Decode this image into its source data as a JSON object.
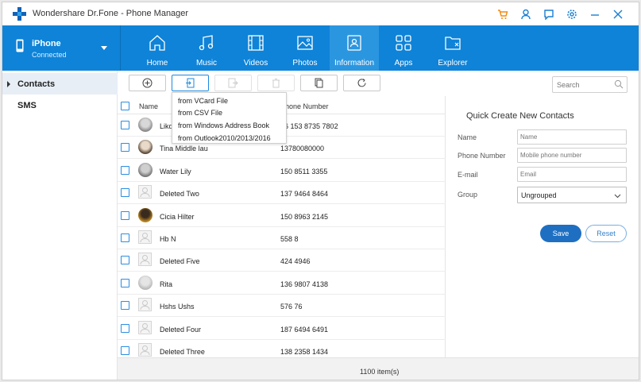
{
  "app": {
    "title": "Wondershare Dr.Fone - Phone Manager",
    "accent_color": "#0e83d8",
    "titlebar_icons": [
      "cart-icon",
      "user-icon",
      "feedback-icon",
      "gear-icon",
      "minimize-icon",
      "close-icon"
    ]
  },
  "device": {
    "name": "iPhone",
    "status": "Connected"
  },
  "nav": {
    "tabs": [
      {
        "label": "Home",
        "icon": "home-icon"
      },
      {
        "label": "Music",
        "icon": "music-icon"
      },
      {
        "label": "Videos",
        "icon": "videos-icon"
      },
      {
        "label": "Photos",
        "icon": "photos-icon"
      },
      {
        "label": "Information",
        "icon": "information-icon",
        "active": true
      },
      {
        "label": "Apps",
        "icon": "apps-icon"
      },
      {
        "label": "Explorer",
        "icon": "explorer-icon"
      }
    ]
  },
  "sidebar": {
    "items": [
      {
        "label": "Contacts",
        "active": true
      },
      {
        "label": "SMS"
      }
    ]
  },
  "toolbar": {
    "buttons": [
      "add-icon",
      "import-icon",
      "export-icon",
      "delete-icon",
      "merge-icon",
      "refresh-icon"
    ],
    "search_placeholder": "Search"
  },
  "import_menu": {
    "items": [
      "from VCard File",
      "from CSV File",
      "from Windows Address  Book",
      "from Outlook2010/2013/2016"
    ]
  },
  "list": {
    "columns": {
      "name": "Name",
      "phone": "Phone Number"
    },
    "rows": [
      {
        "name": "Likd",
        "phone": "86 153 8735 7802",
        "avatar": "photo"
      },
      {
        "name": "Tina Middle lau",
        "phone": "13780080000",
        "avatar": "photo"
      },
      {
        "name": "Water  Lily",
        "phone": "150 8511 3355",
        "avatar": "photo"
      },
      {
        "name": "Deleted  Two",
        "phone": "137 9464 8464",
        "avatar": "blank"
      },
      {
        "name": "Cicia  Hilter",
        "phone": "150 8963 2145",
        "avatar": "photo"
      },
      {
        "name": "Hb  N",
        "phone": "558 8",
        "avatar": "blank"
      },
      {
        "name": "Deleted  Five",
        "phone": "424 4946",
        "avatar": "blank"
      },
      {
        "name": "Rita",
        "phone": "136 9807 4138",
        "avatar": "photo"
      },
      {
        "name": "Hshs  Ushs",
        "phone": "576 76",
        "avatar": "blank"
      },
      {
        "name": "Deleted  Four",
        "phone": "187 6494 6491",
        "avatar": "blank"
      },
      {
        "name": "Deleted  Three",
        "phone": "138 2358 1434",
        "avatar": "blank"
      }
    ]
  },
  "footer": {
    "count_text": "1100  item(s)"
  },
  "quick_create": {
    "title": "Quick Create New Contacts",
    "name_label": "Name",
    "name_placeholder": "Name",
    "phone_label": "Phone Number",
    "phone_placeholder": "Mobile phone number",
    "email_label": "E-mail",
    "email_placeholder": "Email",
    "group_label": "Group",
    "group_value": "Ungrouped",
    "save_label": "Save",
    "reset_label": "Reset"
  }
}
